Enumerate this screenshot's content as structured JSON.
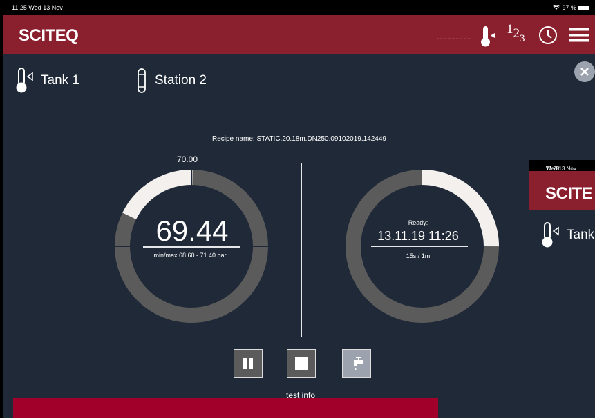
{
  "status_bar": {
    "time": "11.25",
    "date": "Wed 13 Nov",
    "battery": "97 %"
  },
  "header": {
    "logo": "SCITEQ",
    "dashes": "---------",
    "sub_one": "1",
    "sub_two": "2",
    "sub_three": "3"
  },
  "location": {
    "tank": "Tank 1",
    "station": "Station 2"
  },
  "recipe": "Recipe name:  STATIC.20.18m.DN250.09102019.142449",
  "pressure": {
    "setpoint": "70.00",
    "value": "69.44",
    "minmax": "min/max  68.60   -  71.40   bar",
    "ring_fraction": 0.18
  },
  "timer": {
    "status": "Ready:",
    "datetime": "13.11.19  11:26",
    "progress": "15s    /    1m",
    "ring_fraction": 0.25
  },
  "info_text": "test info",
  "overlay": {
    "time": "11.28",
    "date": "Wed 13 Nov",
    "logo": "SCITE",
    "tank": "Tank"
  },
  "colors": {
    "header": "#8a1f2d",
    "background": "#1f2937",
    "ring_track": "#5b5b5b",
    "ring_fill": "#f3f0ee",
    "info_bar": "#a0002a"
  },
  "icons": [
    "wifi-icon",
    "battery-icon",
    "thermometer-icon",
    "numbered-list-icon",
    "clock-icon",
    "hamburger-menu-icon",
    "close-icon",
    "pause-icon",
    "stop-icon",
    "tap-icon",
    "station-icon"
  ]
}
